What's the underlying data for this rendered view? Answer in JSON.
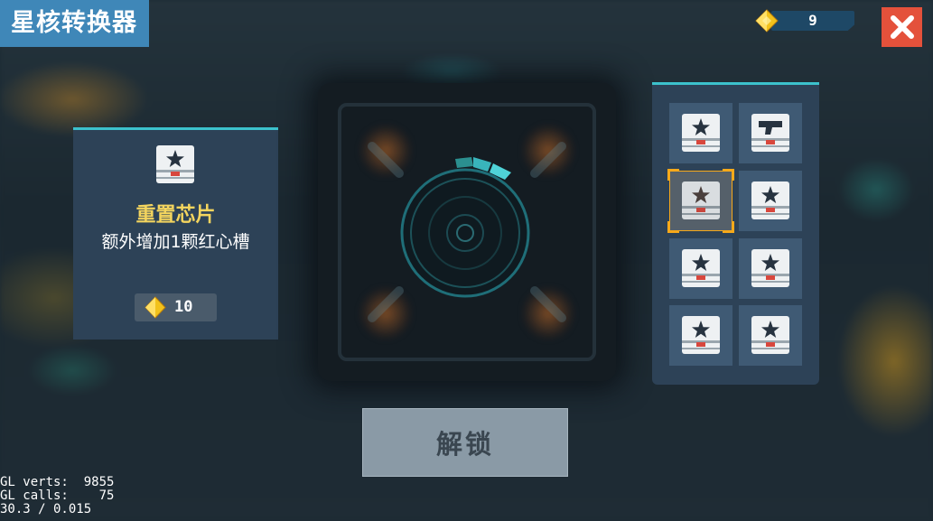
{
  "window": {
    "title": "星核转换器"
  },
  "currency": {
    "icon": "yellow-gem-icon",
    "amount": "9"
  },
  "close": {
    "icon": "close-x-icon",
    "color": "#e4513b"
  },
  "selected_item": {
    "icon": "star-chip-icon",
    "name": "重置芯片",
    "description": "额外增加1颗红心槽",
    "cost_icon": "yellow-gem-icon",
    "cost": "10"
  },
  "slots": [
    {
      "icon": "star-chip-icon"
    },
    {
      "icon": "gun-chip-icon"
    },
    {
      "icon": "star-chip-icon",
      "selected": true
    },
    {
      "icon": "star-chip-icon"
    },
    {
      "icon": "star-chip-icon"
    },
    {
      "icon": "star-chip-icon"
    },
    {
      "icon": "star-chip-icon"
    },
    {
      "icon": "star-chip-icon"
    }
  ],
  "unlock_button": {
    "label": "解锁"
  },
  "debug": {
    "line1": "GL verts:  9855",
    "line2": "GL calls:    75",
    "line3": "30.3 / 0.015"
  },
  "colors": {
    "accent": "#3cc1cc",
    "title_bg": "#3f87b8",
    "item_name": "#f4d55e",
    "selection": "#f7a91a"
  }
}
